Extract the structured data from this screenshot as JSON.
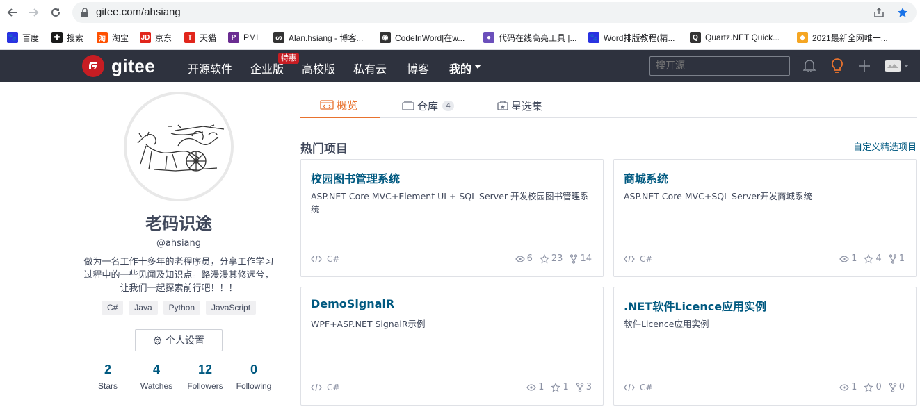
{
  "browser": {
    "url": "gitee.com/ahsiang"
  },
  "bookmarks": [
    {
      "label": "百度",
      "icon": "baidu-icon",
      "color": "#2932e1"
    },
    {
      "label": "搜索",
      "icon": "search-engine-icon",
      "color": "#1a1a1a"
    },
    {
      "label": "淘宝",
      "icon": "taobao-icon",
      "color": "#ff5000"
    },
    {
      "label": "京东",
      "icon": "jd-icon",
      "color": "#e1251b"
    },
    {
      "label": "天猫",
      "icon": "tmall-icon",
      "color": "#e1251b"
    },
    {
      "label": "PMI",
      "icon": "pmi-icon",
      "color": "#6a2c91"
    },
    {
      "label": "Alan.hsiang - 博客...",
      "icon": "cnblogs-icon",
      "color": "#333333"
    },
    {
      "label": "CodeInWord|在w...",
      "icon": "globe-icon",
      "color": "#333333"
    },
    {
      "label": "代码在线高亮工具 |...",
      "icon": "code-highlight-icon",
      "color": "#6b4fbb"
    },
    {
      "label": "Word排版教程(精...",
      "icon": "baidu-paw-icon",
      "color": "#2932e1"
    },
    {
      "label": "Quartz.NET Quick...",
      "icon": "quartz-icon",
      "color": "#333333"
    },
    {
      "label": "2021最新全网唯一...",
      "icon": "cube-icon",
      "color": "#f5a623"
    }
  ],
  "header": {
    "logo_text": "gitee",
    "nav": [
      "开源软件",
      "企业版",
      "高校版",
      "私有云",
      "博客",
      "我的"
    ],
    "hot_badge": "特惠",
    "search_placeholder": "搜开源",
    "brand_color": "#c71d23"
  },
  "profile": {
    "name": "老码识途",
    "username": "@ahsiang",
    "bio": "做为一名工作十多年的老程序员，分享工作学习过程中的一些见闻及知识点。路漫漫其修远兮，让我们一起探索前行吧！！！",
    "tags": [
      "C#",
      "Java",
      "Python",
      "JavaScript"
    ],
    "settings_label": "个人设置",
    "stats": [
      {
        "num": "2",
        "label": "Stars"
      },
      {
        "num": "4",
        "label": "Watches"
      },
      {
        "num": "12",
        "label": "Followers"
      },
      {
        "num": "0",
        "label": "Following"
      }
    ]
  },
  "tabs": {
    "overview": "概览",
    "repos": "仓库",
    "repos_count": "4",
    "collections": "星选集"
  },
  "hot": {
    "title": "热门项目",
    "custom_link": "自定义精选项目"
  },
  "projects": [
    {
      "title": "校园图书管理系统",
      "desc": "ASP.NET Core MVC+Element UI + SQL Server 开发校园图书管理系统",
      "lang": "C#",
      "watch": "6",
      "star": "23",
      "fork": "14"
    },
    {
      "title": "商城系统",
      "desc": "ASP.NET Core MVC+SQL Server开发商城系统",
      "lang": "C#",
      "watch": "1",
      "star": "4",
      "fork": "1"
    },
    {
      "title": "DemoSignalR",
      "desc": "WPF+ASP.NET SignalR示例",
      "lang": "C#",
      "watch": "1",
      "star": "1",
      "fork": "3"
    },
    {
      "title": ".NET软件Licence应用实例",
      "desc": "软件Licence应用实例",
      "lang": "C#",
      "watch": "1",
      "star": "0",
      "fork": "0"
    }
  ]
}
